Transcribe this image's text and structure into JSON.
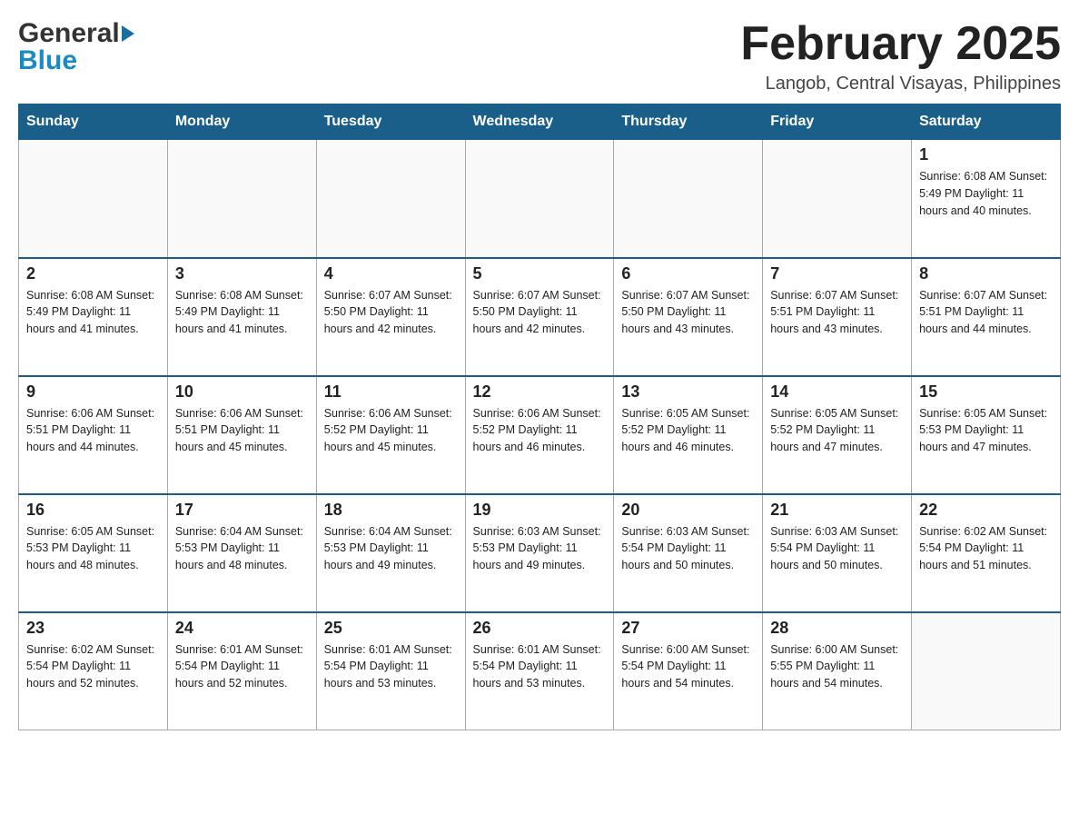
{
  "header": {
    "logo_general": "General",
    "logo_blue": "Blue",
    "month_title": "February 2025",
    "location": "Langob, Central Visayas, Philippines"
  },
  "days_of_week": [
    "Sunday",
    "Monday",
    "Tuesday",
    "Wednesday",
    "Thursday",
    "Friday",
    "Saturday"
  ],
  "weeks": [
    {
      "days": [
        {
          "num": "",
          "info": ""
        },
        {
          "num": "",
          "info": ""
        },
        {
          "num": "",
          "info": ""
        },
        {
          "num": "",
          "info": ""
        },
        {
          "num": "",
          "info": ""
        },
        {
          "num": "",
          "info": ""
        },
        {
          "num": "1",
          "info": "Sunrise: 6:08 AM\nSunset: 5:49 PM\nDaylight: 11 hours and 40 minutes."
        }
      ]
    },
    {
      "days": [
        {
          "num": "2",
          "info": "Sunrise: 6:08 AM\nSunset: 5:49 PM\nDaylight: 11 hours and 41 minutes."
        },
        {
          "num": "3",
          "info": "Sunrise: 6:08 AM\nSunset: 5:49 PM\nDaylight: 11 hours and 41 minutes."
        },
        {
          "num": "4",
          "info": "Sunrise: 6:07 AM\nSunset: 5:50 PM\nDaylight: 11 hours and 42 minutes."
        },
        {
          "num": "5",
          "info": "Sunrise: 6:07 AM\nSunset: 5:50 PM\nDaylight: 11 hours and 42 minutes."
        },
        {
          "num": "6",
          "info": "Sunrise: 6:07 AM\nSunset: 5:50 PM\nDaylight: 11 hours and 43 minutes."
        },
        {
          "num": "7",
          "info": "Sunrise: 6:07 AM\nSunset: 5:51 PM\nDaylight: 11 hours and 43 minutes."
        },
        {
          "num": "8",
          "info": "Sunrise: 6:07 AM\nSunset: 5:51 PM\nDaylight: 11 hours and 44 minutes."
        }
      ]
    },
    {
      "days": [
        {
          "num": "9",
          "info": "Sunrise: 6:06 AM\nSunset: 5:51 PM\nDaylight: 11 hours and 44 minutes."
        },
        {
          "num": "10",
          "info": "Sunrise: 6:06 AM\nSunset: 5:51 PM\nDaylight: 11 hours and 45 minutes."
        },
        {
          "num": "11",
          "info": "Sunrise: 6:06 AM\nSunset: 5:52 PM\nDaylight: 11 hours and 45 minutes."
        },
        {
          "num": "12",
          "info": "Sunrise: 6:06 AM\nSunset: 5:52 PM\nDaylight: 11 hours and 46 minutes."
        },
        {
          "num": "13",
          "info": "Sunrise: 6:05 AM\nSunset: 5:52 PM\nDaylight: 11 hours and 46 minutes."
        },
        {
          "num": "14",
          "info": "Sunrise: 6:05 AM\nSunset: 5:52 PM\nDaylight: 11 hours and 47 minutes."
        },
        {
          "num": "15",
          "info": "Sunrise: 6:05 AM\nSunset: 5:53 PM\nDaylight: 11 hours and 47 minutes."
        }
      ]
    },
    {
      "days": [
        {
          "num": "16",
          "info": "Sunrise: 6:05 AM\nSunset: 5:53 PM\nDaylight: 11 hours and 48 minutes."
        },
        {
          "num": "17",
          "info": "Sunrise: 6:04 AM\nSunset: 5:53 PM\nDaylight: 11 hours and 48 minutes."
        },
        {
          "num": "18",
          "info": "Sunrise: 6:04 AM\nSunset: 5:53 PM\nDaylight: 11 hours and 49 minutes."
        },
        {
          "num": "19",
          "info": "Sunrise: 6:03 AM\nSunset: 5:53 PM\nDaylight: 11 hours and 49 minutes."
        },
        {
          "num": "20",
          "info": "Sunrise: 6:03 AM\nSunset: 5:54 PM\nDaylight: 11 hours and 50 minutes."
        },
        {
          "num": "21",
          "info": "Sunrise: 6:03 AM\nSunset: 5:54 PM\nDaylight: 11 hours and 50 minutes."
        },
        {
          "num": "22",
          "info": "Sunrise: 6:02 AM\nSunset: 5:54 PM\nDaylight: 11 hours and 51 minutes."
        }
      ]
    },
    {
      "days": [
        {
          "num": "23",
          "info": "Sunrise: 6:02 AM\nSunset: 5:54 PM\nDaylight: 11 hours and 52 minutes."
        },
        {
          "num": "24",
          "info": "Sunrise: 6:01 AM\nSunset: 5:54 PM\nDaylight: 11 hours and 52 minutes."
        },
        {
          "num": "25",
          "info": "Sunrise: 6:01 AM\nSunset: 5:54 PM\nDaylight: 11 hours and 53 minutes."
        },
        {
          "num": "26",
          "info": "Sunrise: 6:01 AM\nSunset: 5:54 PM\nDaylight: 11 hours and 53 minutes."
        },
        {
          "num": "27",
          "info": "Sunrise: 6:00 AM\nSunset: 5:54 PM\nDaylight: 11 hours and 54 minutes."
        },
        {
          "num": "28",
          "info": "Sunrise: 6:00 AM\nSunset: 5:55 PM\nDaylight: 11 hours and 54 minutes."
        },
        {
          "num": "",
          "info": ""
        }
      ]
    }
  ]
}
